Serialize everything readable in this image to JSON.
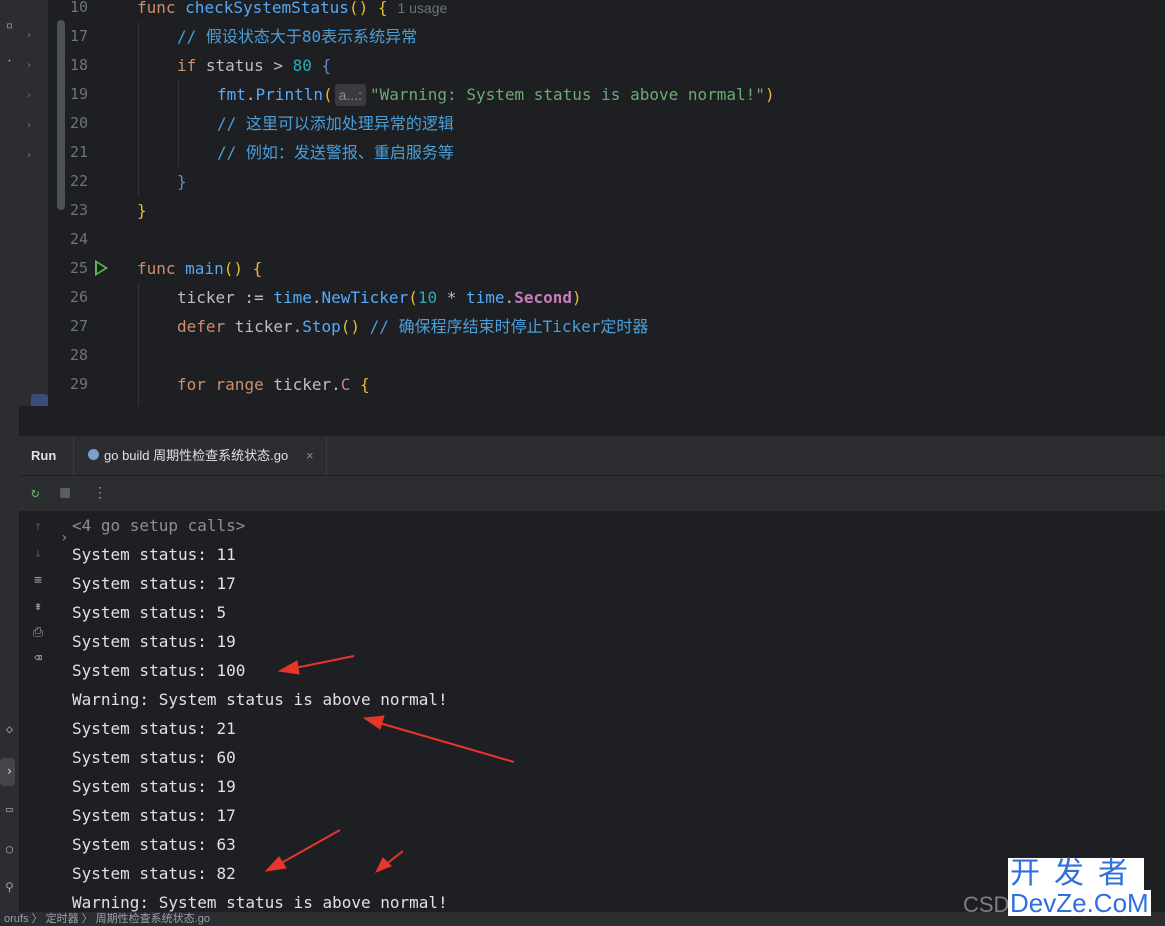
{
  "editor": {
    "lines": [
      {
        "num": "10"
      },
      {
        "num": "17"
      },
      {
        "num": "18"
      },
      {
        "num": "19"
      },
      {
        "num": "20"
      },
      {
        "num": "21"
      },
      {
        "num": "22"
      },
      {
        "num": "23"
      },
      {
        "num": "24"
      },
      {
        "num": "25"
      },
      {
        "num": "26"
      },
      {
        "num": "27"
      },
      {
        "num": "28"
      },
      {
        "num": "29"
      }
    ],
    "code": {
      "l10_kw": "func",
      "l10_fn": "checkSystemStatus",
      "l10_rest": "() {",
      "l10_usage": "1 usage",
      "l17": "// 假设状态大于80表示系统异常",
      "l18_kw": "if",
      "l18_mid": " status > ",
      "l18_num": "80",
      "l18_end": " {",
      "l19_pkg": "fmt",
      "l19_dot": ".",
      "l19_call": "Println",
      "l19_paren": "(",
      "l19_hint": "a...:",
      "l19_str": "\"Warning: System status is above normal!\"",
      "l19_close": ")",
      "l20": "// 这里可以添加处理异常的逻辑",
      "l21": "// 例如：发送警报、重启服务等",
      "l22": "}",
      "l23": "}",
      "l25_kw": "func",
      "l25_fn": "main",
      "l25_rest": "() {",
      "l26_a": "ticker := ",
      "l26_pkg": "time",
      "l26_dot": ".",
      "l26_call": "NewTicker",
      "l26_paren": "(",
      "l26_num": "10",
      "l26_mul": " * ",
      "l26_pkg2": "time",
      "l26_dot2": ".",
      "l26_type": "Second",
      "l26_close": ")",
      "l27_kw": "defer",
      "l27_a": " ticker.",
      "l27_call": "Stop",
      "l27_b": "() ",
      "l27_cm": "// 确保程序结束时停止Ticker定时器",
      "l29_kw1": "for",
      "l29_kw2": " range",
      "l29_a": " ticker.",
      "l29_field": "C",
      "l29_b": " {"
    }
  },
  "run_panel": {
    "label": "Run",
    "tab_label": "go build 周期性检查系统状态.go",
    "tab_close": "×",
    "more_icon": "⋮"
  },
  "console": {
    "setup": "<4 go setup calls>",
    "lines": [
      "System status: 11",
      "System status: 17",
      "System status: 5",
      "System status: 19",
      "System status: 100",
      "Warning: System status is above normal!",
      "System status: 21",
      "System status: 60",
      "System status: 19",
      "System status: 17",
      "System status: 63",
      "System status: 82",
      "Warning: System status is above normal!"
    ]
  },
  "statusbar": {
    "text": "orufs  〉 定时器  〉 周期性检查系统状态.go"
  },
  "watermark": {
    "csd": "CSD",
    "top": "开发者",
    "bottom": "DevZe.CoM"
  },
  "icons": {
    "rerun": "rerun-icon",
    "stop": "stop-icon",
    "up": "arrow-up-icon",
    "down": "arrow-down-icon",
    "softwrap": "soft-wrap-icon",
    "scrollend": "scroll-to-end-icon",
    "print": "print-icon",
    "trash": "trash-icon"
  },
  "annotation_color": "#e8352a"
}
